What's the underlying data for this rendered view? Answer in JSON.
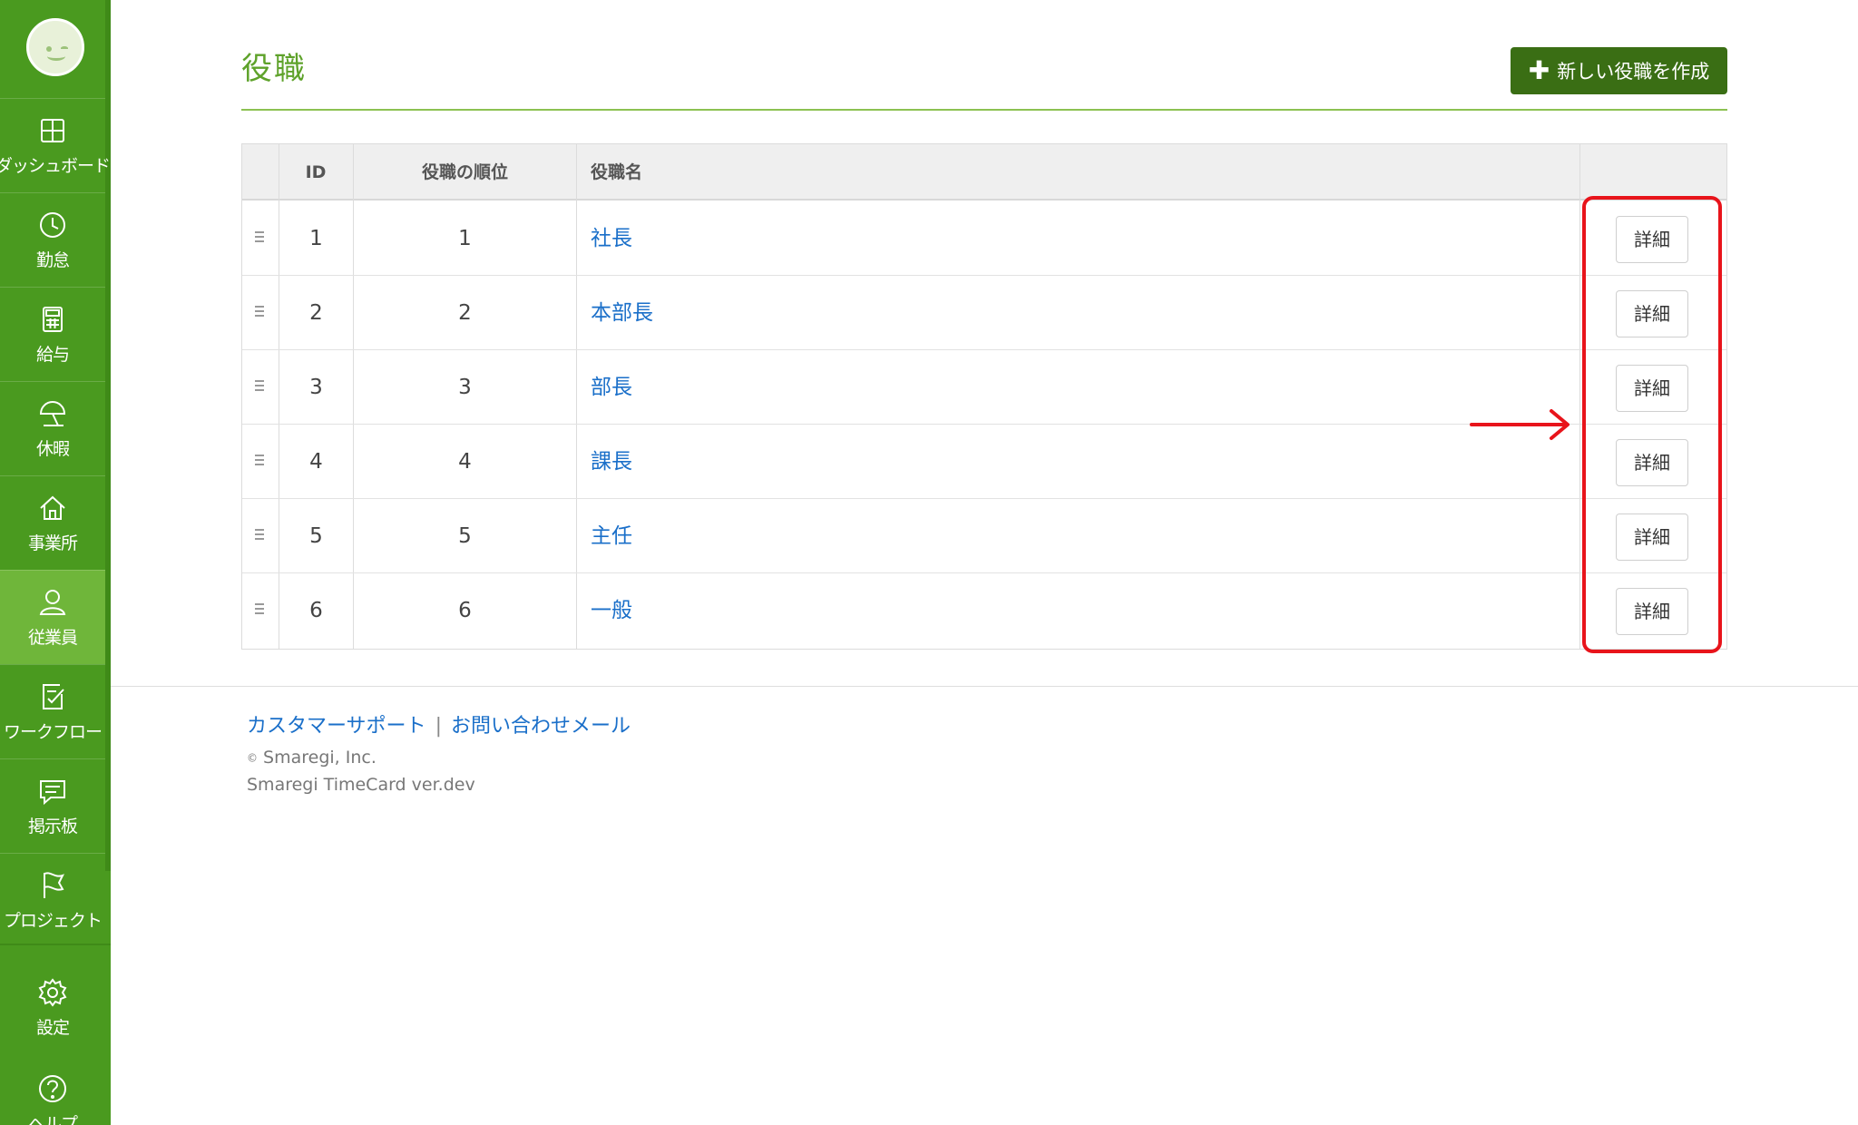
{
  "sidebar": {
    "items": [
      {
        "label": "ダッシュボード",
        "icon": "dashboard-icon"
      },
      {
        "label": "勤怠",
        "icon": "clock-icon"
      },
      {
        "label": "給与",
        "icon": "calculator-icon"
      },
      {
        "label": "休暇",
        "icon": "umbrella-icon"
      },
      {
        "label": "事業所",
        "icon": "home-icon"
      },
      {
        "label": "従業員",
        "icon": "user-icon",
        "active": true
      },
      {
        "label": "ワークフロー",
        "icon": "checklist-icon"
      },
      {
        "label": "掲示板",
        "icon": "message-icon"
      },
      {
        "label": "プロジェクト",
        "icon": "flag-icon"
      },
      {
        "label": "設定",
        "icon": "gear-icon"
      },
      {
        "label": "ヘルプ",
        "icon": "help-icon"
      }
    ]
  },
  "header": {
    "title": "役職",
    "create_button_label": "新しい役職を作成"
  },
  "table": {
    "columns": [
      "ID",
      "役職の順位",
      "役職名"
    ],
    "detail_label": "詳細",
    "rows": [
      {
        "id": "1",
        "rank": "1",
        "name": "社長"
      },
      {
        "id": "2",
        "rank": "2",
        "name": "本部長"
      },
      {
        "id": "3",
        "rank": "3",
        "name": "部長"
      },
      {
        "id": "4",
        "rank": "4",
        "name": "課長"
      },
      {
        "id": "5",
        "rank": "5",
        "name": "主任"
      },
      {
        "id": "6",
        "rank": "6",
        "name": "一般"
      }
    ]
  },
  "footer": {
    "support_link": "カスタマーサポート",
    "separator": "|",
    "contact_link": "お問い合わせメール",
    "copyright_symbol": "©",
    "copyright": "Smaregi, Inc.",
    "version": "Smaregi TimeCard ver.dev"
  },
  "colors": {
    "sidebar": "#4a9a1f",
    "accent": "#5ea22a",
    "primary_button": "#3a6e14",
    "link": "#1a6fc9",
    "highlight": "#e8141b"
  }
}
